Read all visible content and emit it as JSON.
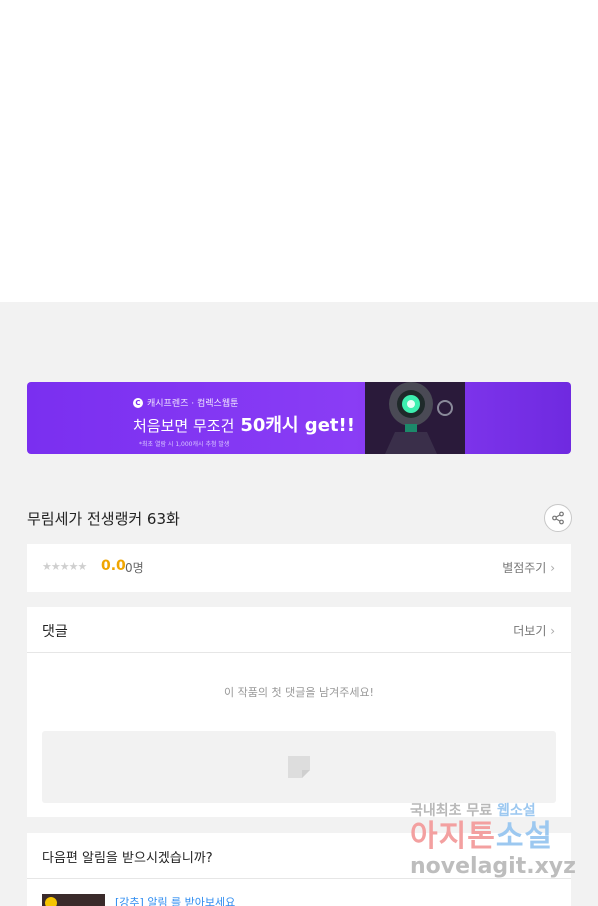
{
  "banner": {
    "brand_icon": "c-logo-icon",
    "brand": "캐시프렌즈 · 컴렉스웹툰",
    "headline_sub": "처음보면 무조건",
    "headline_main": "50캐시 get!!",
    "note": "*최초 열람 시 1,000캐시 추첨 발생",
    "bg_color": "#7a2ff0"
  },
  "episode": {
    "title": "무림세가 전생랭커 63화",
    "share_icon": "share-icon"
  },
  "rating": {
    "stars": "★★★★★",
    "score": "0.0",
    "count": "0명",
    "rate_link": "별점주기",
    "score_color": "#f0a500"
  },
  "comments": {
    "label": "댓글",
    "more_link": "더보기",
    "empty_message": "이 작품의 첫 댓글을 남겨주세요!",
    "input_icon": "image-placeholder-icon"
  },
  "notify": {
    "label": "다음편 알림을 받으시겠습니까?",
    "link": "[강추] 알림 를 받아보세요"
  },
  "watermark": {
    "line1": "국내최초 무료",
    "line1_hl": "웹소설",
    "line2": "아지톤",
    "line2_blue": "소설",
    "line3": "novelagit.xyz"
  }
}
